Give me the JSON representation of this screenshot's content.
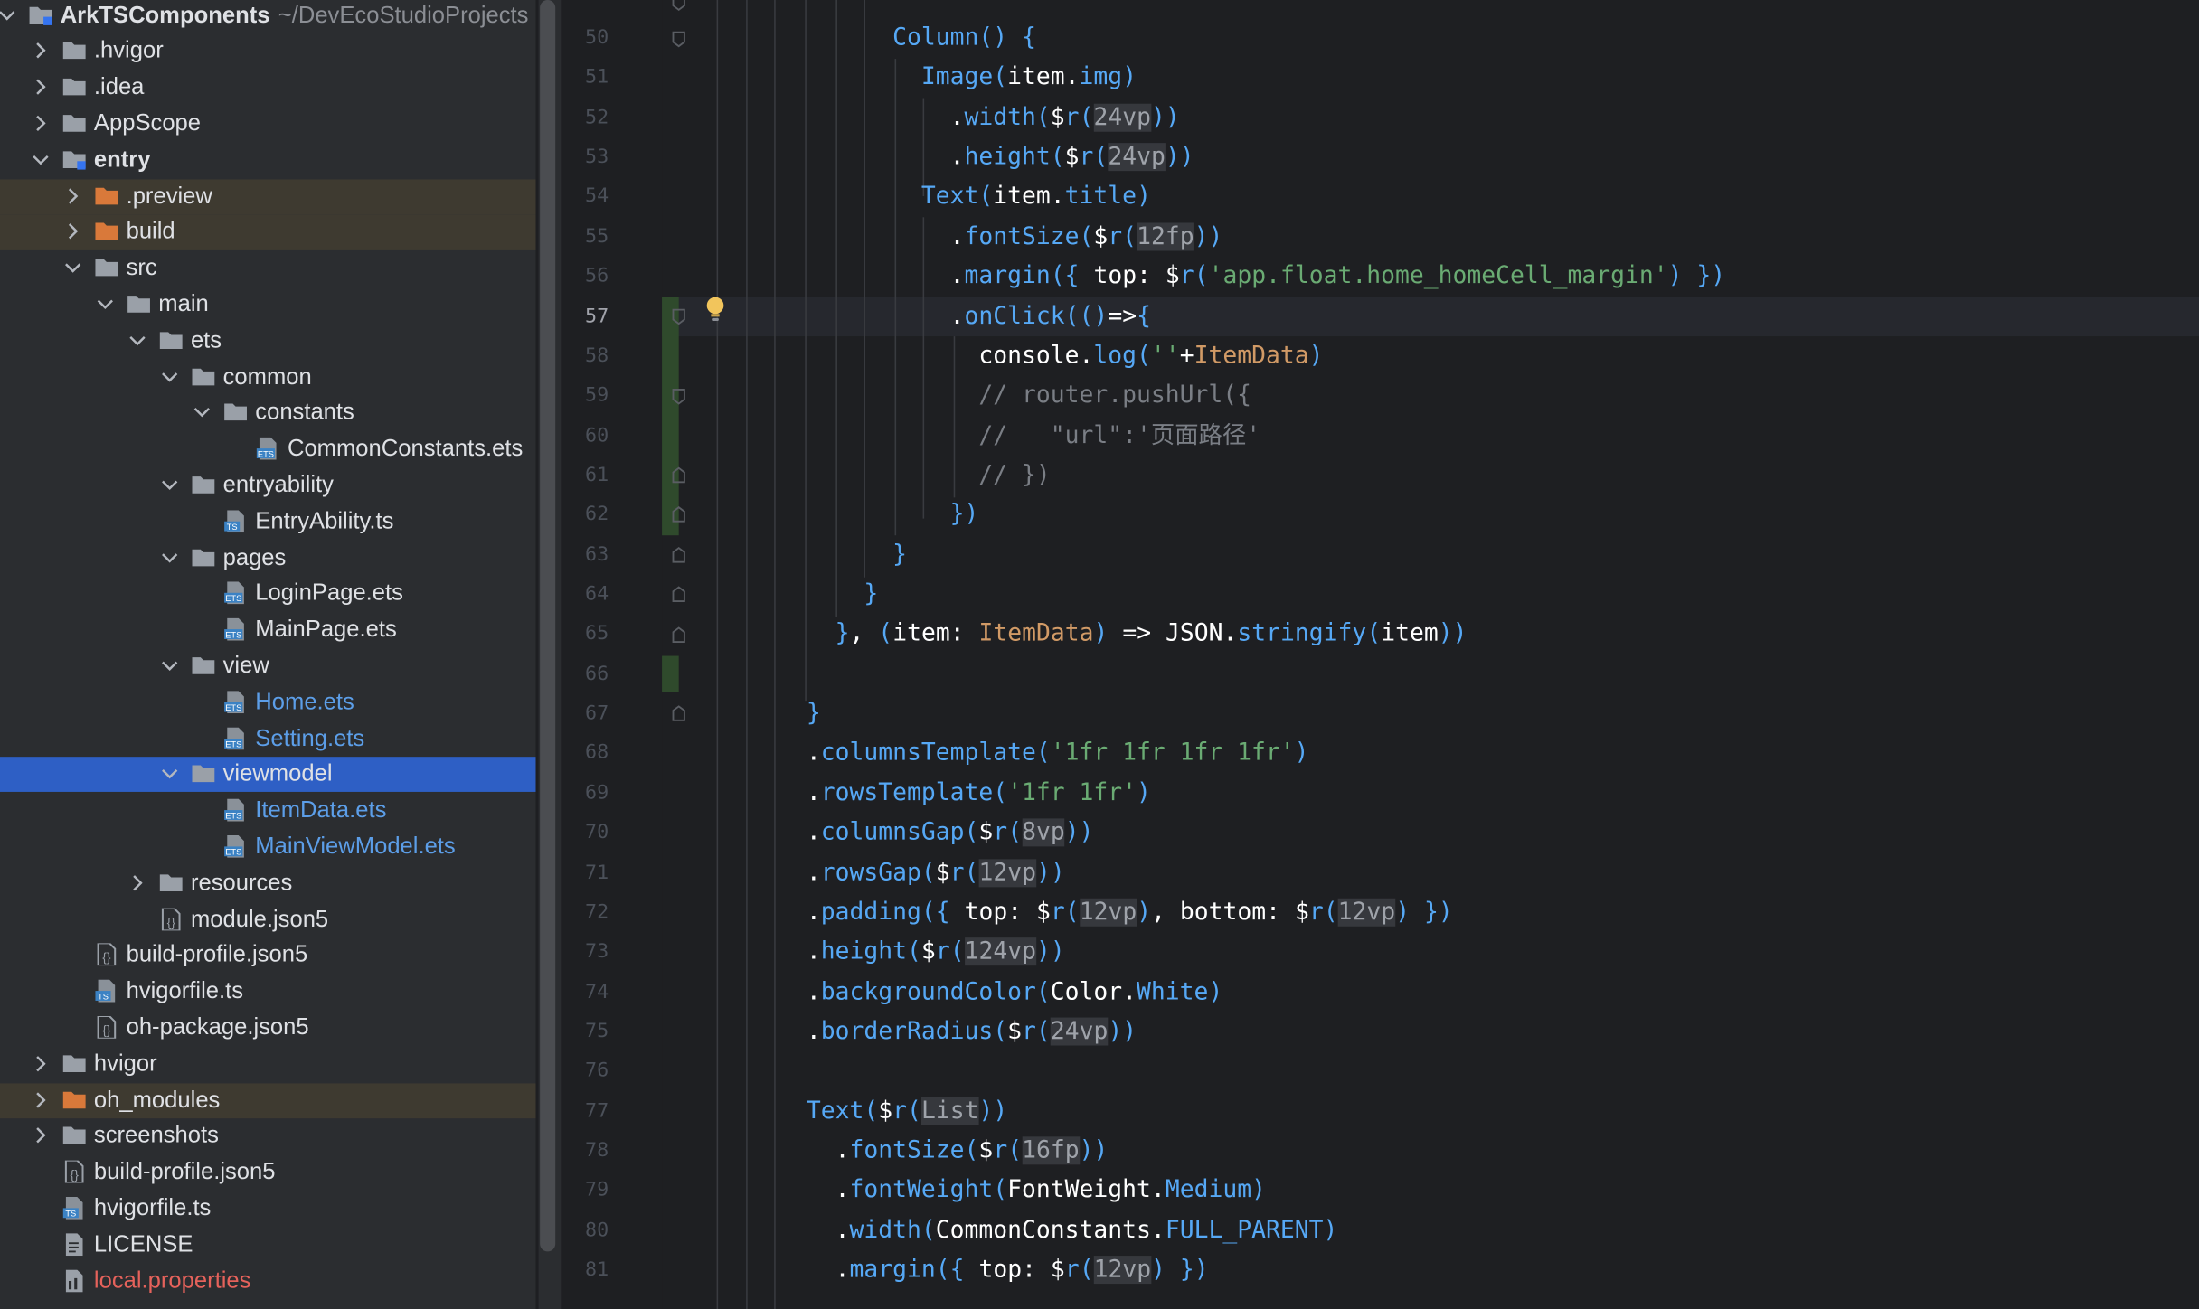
{
  "project": {
    "name": "ArkTSComponents",
    "path": "~/DevEcoStudioProjects"
  },
  "tree": [
    {
      "label": "ArkTSComponents",
      "path": "~/DevEcoStudioProjects",
      "depth": 0,
      "chevron": "down",
      "icon": "folder-module-icon",
      "bold": true
    },
    {
      "label": ".hvigor",
      "depth": 1,
      "chevron": "right",
      "icon": "folder-icon"
    },
    {
      "label": ".idea",
      "depth": 1,
      "chevron": "right",
      "icon": "folder-icon"
    },
    {
      "label": "AppScope",
      "depth": 1,
      "chevron": "right",
      "icon": "folder-icon"
    },
    {
      "label": "entry",
      "depth": 1,
      "chevron": "down",
      "icon": "folder-module-icon",
      "bold": true
    },
    {
      "label": ".preview",
      "depth": 2,
      "chevron": "right",
      "icon": "folder-orange-icon",
      "highlight": "orange"
    },
    {
      "label": "build",
      "depth": 2,
      "chevron": "right",
      "icon": "folder-orange-icon",
      "highlight": "orange"
    },
    {
      "label": "src",
      "depth": 2,
      "chevron": "down",
      "icon": "folder-icon"
    },
    {
      "label": "main",
      "depth": 3,
      "chevron": "down",
      "icon": "folder-icon"
    },
    {
      "label": "ets",
      "depth": 4,
      "chevron": "down",
      "icon": "folder-icon"
    },
    {
      "label": "common",
      "depth": 5,
      "chevron": "down",
      "icon": "folder-icon"
    },
    {
      "label": "constants",
      "depth": 6,
      "chevron": "down",
      "icon": "folder-icon"
    },
    {
      "label": "CommonConstants.ets",
      "depth": 7,
      "icon": "ets-file-icon"
    },
    {
      "label": "entryability",
      "depth": 5,
      "chevron": "down",
      "icon": "folder-icon"
    },
    {
      "label": "EntryAbility.ts",
      "depth": 6,
      "icon": "ts-file-icon"
    },
    {
      "label": "pages",
      "depth": 5,
      "chevron": "down",
      "icon": "folder-icon"
    },
    {
      "label": "LoginPage.ets",
      "depth": 6,
      "icon": "ets-file-icon"
    },
    {
      "label": "MainPage.ets",
      "depth": 6,
      "icon": "ets-file-icon"
    },
    {
      "label": "view",
      "depth": 5,
      "chevron": "down",
      "icon": "folder-icon"
    },
    {
      "label": "Home.ets",
      "depth": 6,
      "icon": "ets-file-icon",
      "color": "blue"
    },
    {
      "label": "Setting.ets",
      "depth": 6,
      "icon": "ets-file-icon",
      "color": "blue"
    },
    {
      "label": "viewmodel",
      "depth": 5,
      "chevron": "down",
      "icon": "folder-icon",
      "selected": true
    },
    {
      "label": "ItemData.ets",
      "depth": 6,
      "icon": "ets-file-icon",
      "color": "blue"
    },
    {
      "label": "MainViewModel.ets",
      "depth": 6,
      "icon": "ets-file-icon",
      "color": "blue"
    },
    {
      "label": "resources",
      "depth": 4,
      "chevron": "right",
      "icon": "folder-icon"
    },
    {
      "label": "module.json5",
      "depth": 4,
      "icon": "json-file-icon"
    },
    {
      "label": "build-profile.json5",
      "depth": 2,
      "icon": "json-file-icon"
    },
    {
      "label": "hvigorfile.ts",
      "depth": 2,
      "icon": "ts-file-icon"
    },
    {
      "label": "oh-package.json5",
      "depth": 2,
      "icon": "json-file-icon"
    },
    {
      "label": "hvigor",
      "depth": 1,
      "chevron": "right",
      "icon": "folder-icon"
    },
    {
      "label": "oh_modules",
      "depth": 1,
      "chevron": "right",
      "icon": "folder-orange-icon",
      "highlight": "orange"
    },
    {
      "label": "screenshots",
      "depth": 1,
      "chevron": "right",
      "icon": "folder-icon"
    },
    {
      "label": "build-profile.json5",
      "depth": 1,
      "icon": "json-file-icon"
    },
    {
      "label": "hvigorfile.ts",
      "depth": 1,
      "icon": "ts-file-icon"
    },
    {
      "label": "LICENSE",
      "depth": 1,
      "icon": "text-file-icon"
    },
    {
      "label": "local.properties",
      "depth": 1,
      "icon": "properties-file-icon",
      "color": "red"
    }
  ],
  "editor": {
    "current_line": 57,
    "lines": [
      {
        "n": "50",
        "text": "      Column() {"
      },
      {
        "n": "51",
        "text": "        Image(item.img)"
      },
      {
        "n": "52",
        "text": "          .width($r(24vp))"
      },
      {
        "n": "53",
        "text": "          .height($r(24vp))"
      },
      {
        "n": "54",
        "text": "        Text(item.title)"
      },
      {
        "n": "55",
        "text": "          .fontSize($r(12fp))"
      },
      {
        "n": "56",
        "text": "          .margin({ top: $r('app.float.home_homeCell_margin') })"
      },
      {
        "n": "57",
        "text": "          .onClick(()=>{"
      },
      {
        "n": "58",
        "text": "            console.log(''+ItemData)"
      },
      {
        "n": "59",
        "text": "            // router.pushUrl({"
      },
      {
        "n": "60",
        "text": "            //   \"url\":'页面路径'"
      },
      {
        "n": "61",
        "text": "            // })"
      },
      {
        "n": "62",
        "text": "          })"
      },
      {
        "n": "63",
        "text": "      }"
      },
      {
        "n": "64",
        "text": "    }"
      },
      {
        "n": "65",
        "text": "  }, (item: ItemData) => JSON.stringify(item))"
      },
      {
        "n": "66",
        "text": ""
      },
      {
        "n": "67",
        "text": "}"
      },
      {
        "n": "68",
        "text": ".columnsTemplate('1fr 1fr 1fr 1fr')"
      },
      {
        "n": "69",
        "text": ".rowsTemplate('1fr 1fr')"
      },
      {
        "n": "70",
        "text": ".columnsGap($r(8vp))"
      },
      {
        "n": "71",
        "text": ".rowsGap($r(12vp))"
      },
      {
        "n": "72",
        "text": ".padding({ top: $r(12vp), bottom: $r(12vp) })"
      },
      {
        "n": "73",
        "text": ".height($r(124vp))"
      },
      {
        "n": "74",
        "text": ".backgroundColor(Color.White)"
      },
      {
        "n": "75",
        "text": ".borderRadius($r(24vp))"
      },
      {
        "n": "76",
        "text": ""
      },
      {
        "n": "77",
        "text": "Text($r(List))"
      },
      {
        "n": "78",
        "text": "  .fontSize($r(16fp))"
      },
      {
        "n": "79",
        "text": "  .fontWeight(FontWeight.Medium)"
      },
      {
        "n": "80",
        "text": "  .width(CommonConstants.FULL_PARENT)"
      },
      {
        "n": "81",
        "text": "  .margin({ top: $r(12vp) })"
      }
    ]
  },
  "colors": {
    "selection": "#2e5fc5",
    "orange_folder": "#d9793a",
    "folder": "#9aa0a8",
    "function": "#56a8f5",
    "string": "#6aab73",
    "comment": "#7a7e85"
  }
}
